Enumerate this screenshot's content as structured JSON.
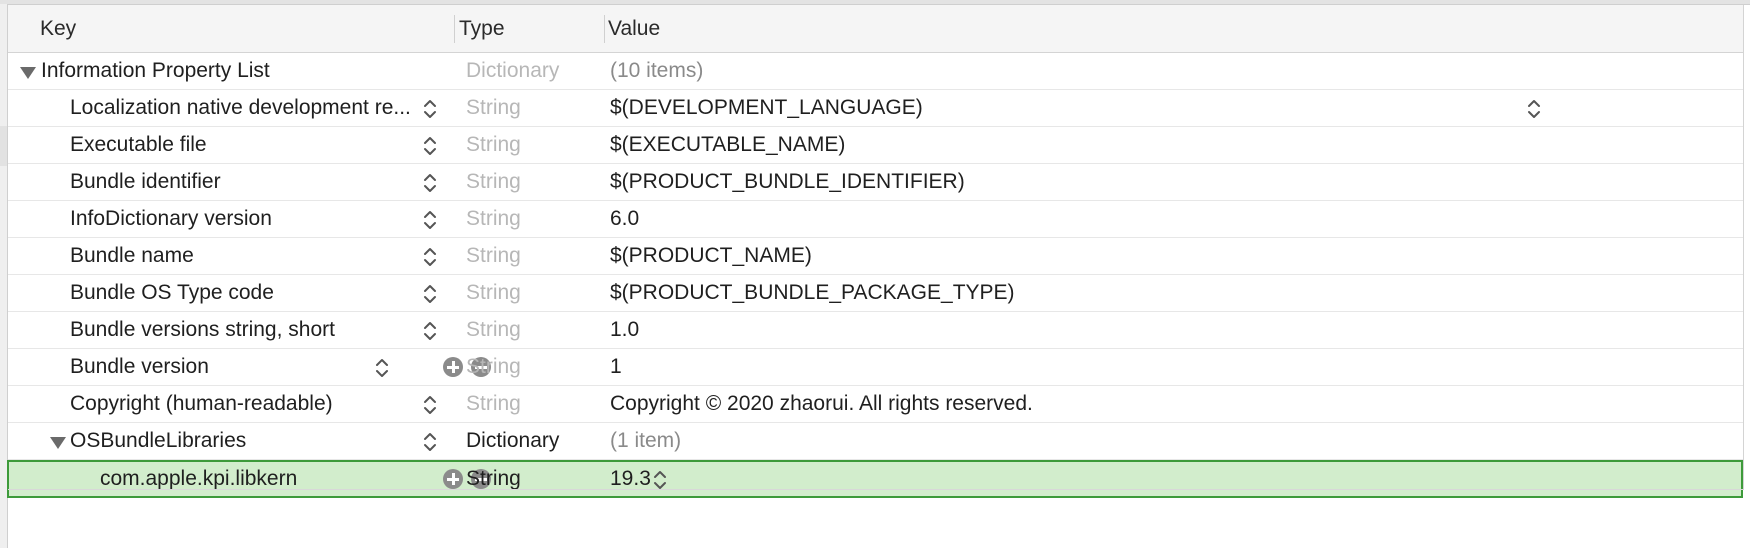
{
  "header": {
    "key_label": "Key",
    "type_label": "Type",
    "value_label": "Value"
  },
  "rows": [
    {
      "key": "Information Property List",
      "type": "Dictionary",
      "value": "(10 items)"
    },
    {
      "key": "Localization native development re...",
      "type": "String",
      "value": "$(DEVELOPMENT_LANGUAGE)"
    },
    {
      "key": "Executable file",
      "type": "String",
      "value": "$(EXECUTABLE_NAME)"
    },
    {
      "key": "Bundle identifier",
      "type": "String",
      "value": "$(PRODUCT_BUNDLE_IDENTIFIER)"
    },
    {
      "key": "InfoDictionary version",
      "type": "String",
      "value": "6.0"
    },
    {
      "key": "Bundle name",
      "type": "String",
      "value": "$(PRODUCT_NAME)"
    },
    {
      "key": "Bundle OS Type code",
      "type": "String",
      "value": "$(PRODUCT_BUNDLE_PACKAGE_TYPE)"
    },
    {
      "key": "Bundle versions string, short",
      "type": "String",
      "value": "1.0"
    },
    {
      "key": "Bundle version",
      "type": "String",
      "value": "1"
    },
    {
      "key": "Copyright (human-readable)",
      "type": "String",
      "value": "Copyright © 2020 zhaorui. All rights reserved."
    },
    {
      "key": "OSBundleLibraries",
      "type": "Dictionary",
      "value": "(1 item)"
    },
    {
      "key": "com.apple.kpi.libkern",
      "type": "String",
      "value": "19.3"
    }
  ],
  "icons": {
    "disclosure": "disclosure-triangle-icon",
    "stepper": "up-down-stepper-icon",
    "add": "plus-circle-icon",
    "remove": "minus-circle-icon"
  },
  "colors": {
    "selection_fill": "#d2edcc",
    "selection_border": "#3d9a3a",
    "dim_text": "#b7b7b7"
  }
}
